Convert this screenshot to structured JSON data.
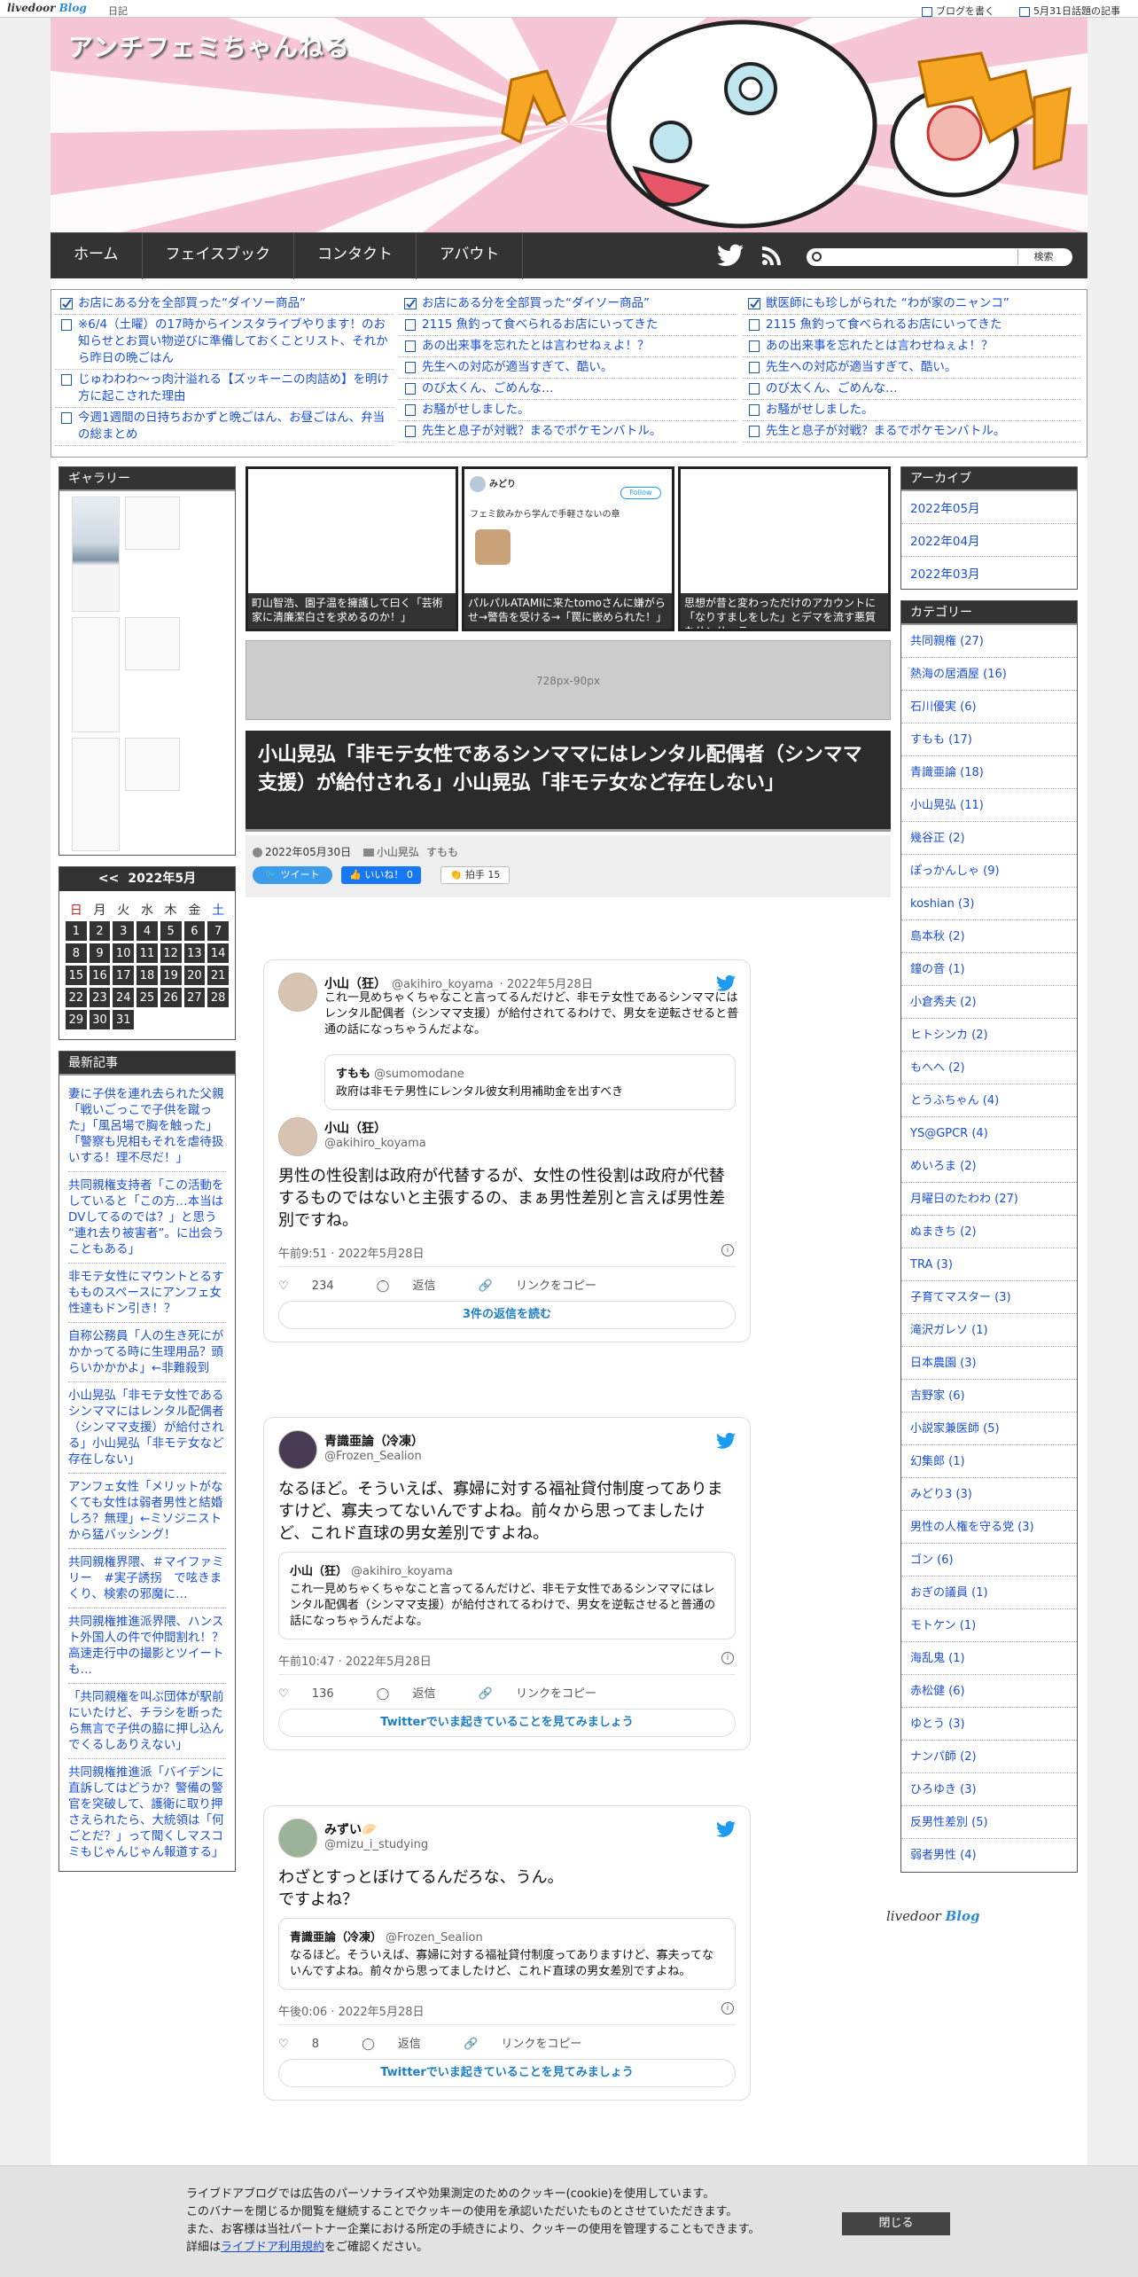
{
  "topbar": {
    "logo_a": "livedoor",
    "logo_b": "Blog",
    "diary": "日記",
    "write": "ブログを書く",
    "topic": "5月31日話題の記事"
  },
  "header": {
    "title": "アンチフェミちゃんねる"
  },
  "nav": {
    "items": [
      "ホーム",
      "フェイスブック",
      "コンタクト",
      "アバウト"
    ],
    "search_button": "検索",
    "search_placeholder": ""
  },
  "ticker": {
    "col1": [
      "お店にある分を全部買った“ダイソー商品”",
      "※6/4（土曜）の17時からインスタライブやります！のお知らせとお買い物逆びに準備しておくことリスト、それから昨日の晩ごはん",
      "じゅわわわ～っ肉汁溢れる【ズッキーニの肉詰め】を明け方に起こされた理由",
      "今週1週間の日持ちおかずと晩ごはん、お昼ごはん、弁当の総まとめ"
    ],
    "col2": [
      "お店にある分を全部買った“ダイソー商品”",
      "2115 魚釣って食べられるお店にいってきた",
      "あの出来事を忘れたとは言わせねぇよ！？",
      "先生への対応が適当すぎて、酷い。",
      "のび太くん、ごめんな…",
      "お騒がせしました。",
      "先生と息子が対戦？まるでポケモンバトル。"
    ],
    "col3": [
      "獣医師にも珍しがられた “わが家のニャンコ”",
      "2115 魚釣って食べられるお店にいってきた",
      "あの出来事を忘れたとは言わせねぇよ！？",
      "先生への対応が適当すぎて、酷い。",
      "のび太くん、ごめんな…",
      "お騒がせしました。",
      "先生と息子が対戦？まるでポケモンバトル。"
    ]
  },
  "gallery": {
    "title": "ギャラリー"
  },
  "calendar": {
    "prev": "<<",
    "month": "2022年5月",
    "weekdays": [
      "日",
      "月",
      "火",
      "水",
      "木",
      "金",
      "土"
    ],
    "rows": [
      [
        "1",
        "2",
        "3",
        "4",
        "5",
        "6",
        "7"
      ],
      [
        "8",
        "9",
        "10",
        "11",
        "12",
        "13",
        "14"
      ],
      [
        "15",
        "16",
        "17",
        "18",
        "19",
        "20",
        "21"
      ],
      [
        "22",
        "23",
        "24",
        "25",
        "26",
        "27",
        "28"
      ],
      [
        "29",
        "30",
        "31",
        "",
        "",
        "",
        ""
      ]
    ]
  },
  "recent": {
    "title": "最新記事",
    "items": [
      "妻に子供を連れ去られた父親「戦いごっこで子供を蹴った」「風呂場で胸を触った」「警察も児相もそれを虐待扱いする！理不尽だ！」",
      "共同親権支持者「この活動をしていると「この方…本当はDVしてるのでは？」と思う “連れ去り被害者”。に出会うこともある」",
      "非モテ女性にマウントとるすもものスペースにアンフェ女性達もドン引き！？",
      "自称公務員「人の生き死にがかかってる時に生理用品？頭らいかかかよ」←非難殺到",
      "小山晃弘「非モテ女性であるシンママにはレンタル配偶者（シンママ支援）が給付される」小山晃弘「非モテ女など存在しない」",
      "アンフェ女性「メリットがなくても女性は弱者男性と結婚しろ？無理」←ミソジニストから猛バッシング！",
      "共同親権界隈、＃マイファミリー　#実子誘拐　で呟きまくり、検索の邪魔に…",
      "共同親権推進派界隈、ハンスト外国人の件で仲間割れ！？高速走行中の撮影とツイートも…",
      "「共同親権を叫ぶ団体が駅前にいたけど、チラシを断ったら無言で子供の脇に押し込んでくるしありえない」",
      "共同親権推進派「バイデンに直訴してはどうか？警備の警官を突破して、護衛に取り押さえられたら、大統領は「何ごとだ？」って聞くしマスコミもじゃんじゃん報道する」"
    ]
  },
  "featured": [
    {
      "caption": "町山智浩、園子温を擁護して曰く「芸術家に清廉潔白さを求めるのか！」"
    },
    {
      "caption": "パルパルATAMIに来たtomoさんに嫌がらせ→警告を受ける→「罠に嵌められた！」",
      "tw_name": "みどり",
      "tw_btn": "Follow",
      "tw_text": "フェミ飲みから学んで手軽さないの章"
    },
    {
      "caption": "思想が昔と変わっただけのアカウントに「なりすましをした」とデマを流す悪質なサンサーラ"
    }
  ],
  "ad": {
    "label": "728px-90px"
  },
  "article": {
    "title": "小山晃弘「非モテ女性であるシンママにはレンタル配偶者（シンママ支援）が給付される」小山晃弘「非モテ女など存在しない」",
    "date": "2022年05月30日",
    "cat1": "小山晃弘",
    "cat2": "すもも",
    "tweet_btn": "ツイート",
    "like_btn": "いいね！ 0",
    "clap": "拍手",
    "clap_count": "15"
  },
  "tweets": [
    {
      "name": "小山（狂）",
      "handle": "@akihiro_koyama",
      "date": "· 2022年5月28日",
      "intro": "これ一見めちゃくちゃなこと言ってるんだけど、非モテ女性であるシンママにはレンタル配偶者（シンママ支援）が給付されてるわけで、男女を逆転させると普通の話になっちゃうんだよな。",
      "quote_name": "すもも",
      "quote_handle": "@sumomodane",
      "quote_text": "政府は非モテ男性にレンタル彼女利用補助金を出すべき",
      "name2": "小山（狂）",
      "handle2": "@akihiro_koyama",
      "text": "男性の性役割は政府が代替するが、女性の性役割は政府が代替するものではないと主張するの、まぁ男性差別と言えば男性差別ですね。",
      "time": "午前9:51 · 2022年5月28日",
      "likes": "234",
      "reply": "返信",
      "copy": "リンクをコピー",
      "more": "3件の返信を読む"
    },
    {
      "name": "青識亜論（冷凍）",
      "handle": "@Frozen_Sealion",
      "text": "なるほど。そういえば、寡婦に対する福祉貸付制度ってありますけど、寡夫ってないんですよね。前々から思ってましたけど、これド直球の男女差別ですよね。",
      "quote_name": "小山（狂）",
      "quote_handle": "@akihiro_koyama",
      "quote_text": "これ一見めちゃくちゃなこと言ってるんだけど、非モテ女性であるシンママにはレンタル配偶者（シンママ支援）が給付されてるわけで、男女を逆転させると普通の話になっちゃうんだよな。",
      "time": "午前10:47 · 2022年5月28日",
      "likes": "136",
      "reply": "返信",
      "copy": "リンクをコピー",
      "more": "Twitterでいま起きていることを見てみましょう"
    },
    {
      "name": "みずい🥟",
      "handle": "@mizu_i_studying",
      "text": "わざとすっとぼけてるんだろな、うん。\nですよね？",
      "quote_name": "青識亜論（冷凍）",
      "quote_handle": "@Frozen_Sealion",
      "quote_text": "なるほど。そういえば、寡婦に対する福祉貸付制度ってありますけど、寡夫ってないんですよね。前々から思ってましたけど、これド直球の男女差別ですよね。",
      "time": "午後0:06 · 2022年5月28日",
      "likes": "8",
      "reply": "返信",
      "copy": "リンクをコピー",
      "more": "Twitterでいま起きていることを見てみましょう"
    }
  ],
  "archive": {
    "title": "アーカイブ",
    "items": [
      "2022年05月",
      "2022年04月",
      "2022年03月"
    ]
  },
  "categories": {
    "title": "カテゴリー",
    "items": [
      "共同親権 (27)",
      "熱海の居酒屋 (16)",
      "石川優実 (6)",
      "すもも (17)",
      "青識亜論 (18)",
      "小山晃弘 (11)",
      "幾谷正 (2)",
      "ぽっかんしゃ (9)",
      "koshian (3)",
      "島本秋 (2)",
      "鐘の音 (1)",
      "小倉秀夫 (2)",
      "ヒトシンカ (2)",
      "もへへ (2)",
      "とうふちゃん (4)",
      "YS@GPCR (4)",
      "めいろま (2)",
      "月曜日のたわわ (27)",
      "ぬまきち (2)",
      "TRA (3)",
      "子育てマスター (3)",
      "滝沢ガレソ (1)",
      "日本農園 (3)",
      "吉野家 (6)",
      "小説家兼医師 (5)",
      "幻集郎 (1)",
      "みどり3 (3)",
      "男性の人権を守る党 (3)",
      "ゴン (6)",
      "おぎの議員 (1)",
      "モトケン (1)",
      "海乱鬼 (1)",
      "赤松健 (6)",
      "ゆとう (3)",
      "ナンパ師 (2)",
      "ひろゆき (3)",
      "反男性差別 (5)",
      "弱者男性 (4)"
    ]
  },
  "footer_logo": {
    "a": "livedoor",
    "b": "Blog"
  },
  "cookie": {
    "l1": "ライブドアブログでは広告のパーソナライズや効果測定のためのクッキー(cookie)を使用しています。",
    "l2": "このバナーを閉じるか閲覧を継続することでクッキーの使用を承認いただいたものとさせていただきます。",
    "l3": "また、お客様は当社パートナー企業における所定の手続きにより、クッキーの使用を管理することもできます。",
    "l4a": "詳細は",
    "l4link": "ライブドア利用規約",
    "l4b": "をご確認ください。",
    "close": "閉じる"
  },
  "colors": {
    "accent": "#1a4fd4",
    "nav": "#333333",
    "header_bg": "#f7c6d6",
    "twitter": "#1d9bf0"
  }
}
